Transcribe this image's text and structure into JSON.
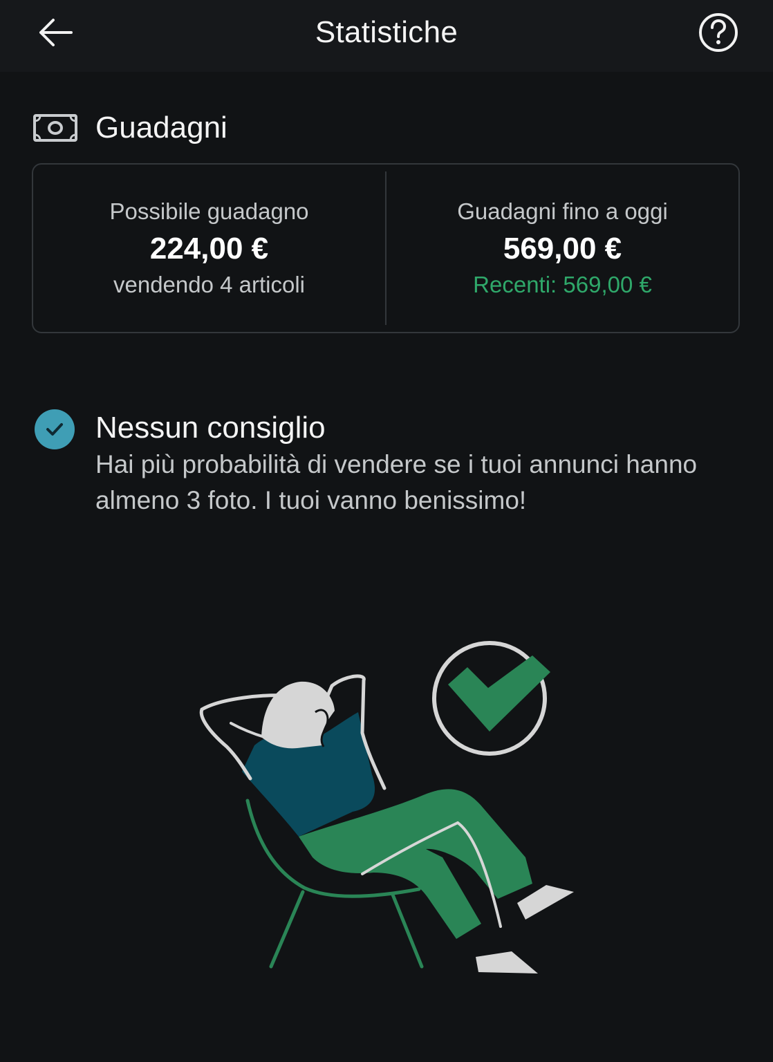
{
  "header": {
    "title": "Statistiche",
    "back_icon": "arrow-left-icon",
    "help_icon": "question-circle-icon"
  },
  "earnings": {
    "section_title": "Guadagni",
    "section_icon": "banknote-icon",
    "potential": {
      "label": "Possibile guadagno",
      "value": "224,00 €",
      "sub": "vendendo 4 articoli"
    },
    "to_date": {
      "label": "Guadagni fino a oggi",
      "value": "569,00 €",
      "sub": "Recenti: 569,00 €"
    }
  },
  "tip": {
    "icon": "check-circle-icon",
    "title": "Nessun consiglio",
    "body": "Hai più probabilità di vendere se i tuoi annunci hanno almeno 3 foto. I tuoi vanno benissimo!"
  },
  "illustration": {
    "icon": "relaxing-person-illustration"
  },
  "colors": {
    "background": "#111315",
    "topbar": "#16181b",
    "accent_green": "#2fa86a",
    "accent_teal": "#3f9eb5",
    "shirt": "#0a4a5c",
    "pants": "#2a8556"
  }
}
